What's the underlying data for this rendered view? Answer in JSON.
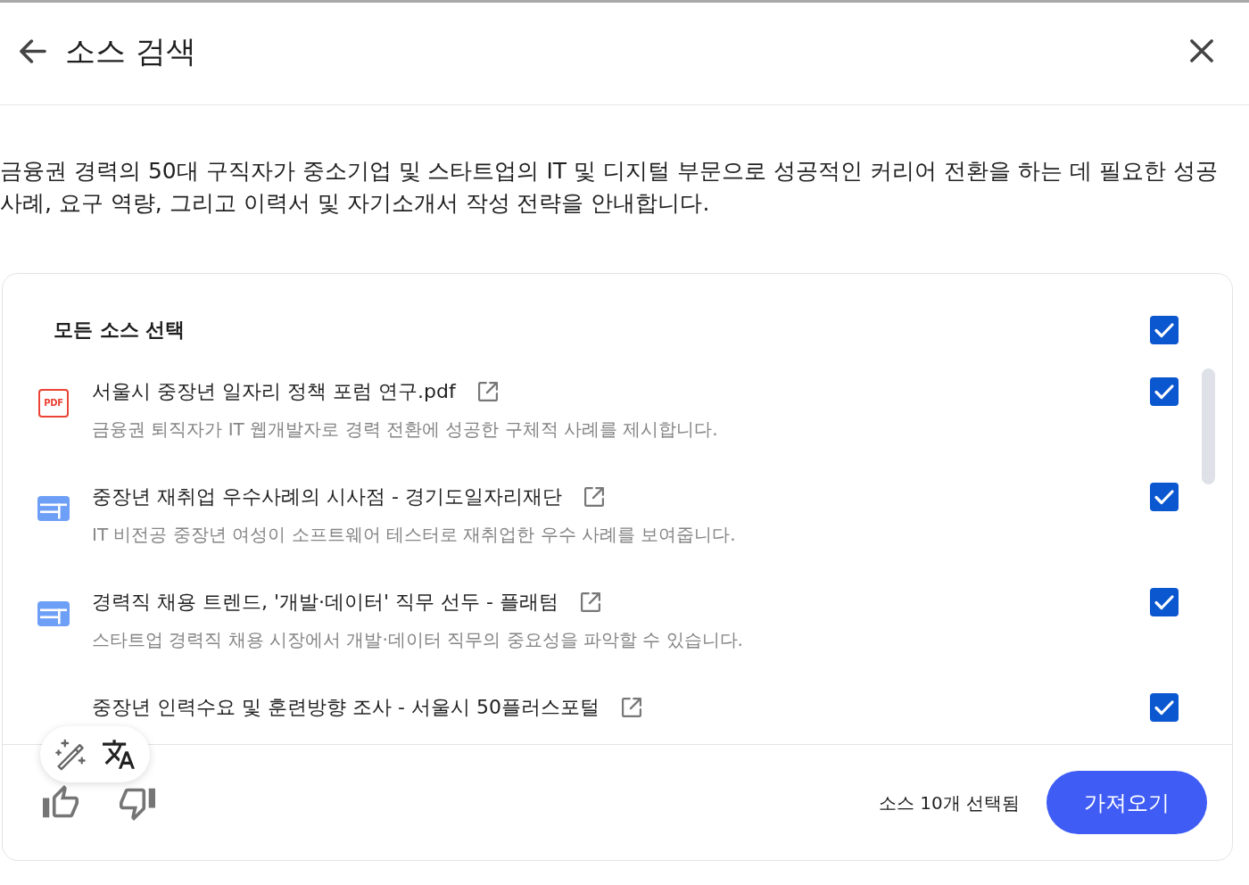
{
  "header": {
    "title": "소스 검색"
  },
  "description": "금융권 경력의 50대 구직자가 중소기업 및 스타트업의 IT 및 디지털 부문으로 성공적인 커리어 전환을 하는 데 필요한 성공 사례, 요구 역량, 그리고 이력서 및 자기소개서 작성 전략을 안내합니다.",
  "select_all": {
    "label": "모든 소스 선택",
    "checked": true
  },
  "sources": [
    {
      "kind": "pdf",
      "icon_label": "PDF",
      "title": "서울시 중장년 일자리 정책 포럼 연구.pdf",
      "description": "금융권 퇴직자가 IT 웹개발자로 경력 전환에 성공한 구체적 사례를 제시합니다.",
      "checked": true
    },
    {
      "kind": "web",
      "title": "중장년 재취업 우수사례의 시사점 - 경기도일자리재단",
      "description": "IT 비전공 중장년 여성이 소프트웨어 테스터로 재취업한 우수 사례를 보여줍니다.",
      "checked": true
    },
    {
      "kind": "web",
      "title": "경력직 채용 트렌드, '개발·데이터' 직무 선두 - 플래텀",
      "description": "스타트업 경력직 채용 시장에서 개발·데이터 직무의 중요성을 파악할 수 있습니다.",
      "checked": true
    },
    {
      "title": "중장년 인력수요 및 훈련방향 조사 - 서울시 50플러스포털",
      "checked": true
    }
  ],
  "footer": {
    "selected_count": "소스 10개 선택됨",
    "import_button": "가져오기"
  }
}
